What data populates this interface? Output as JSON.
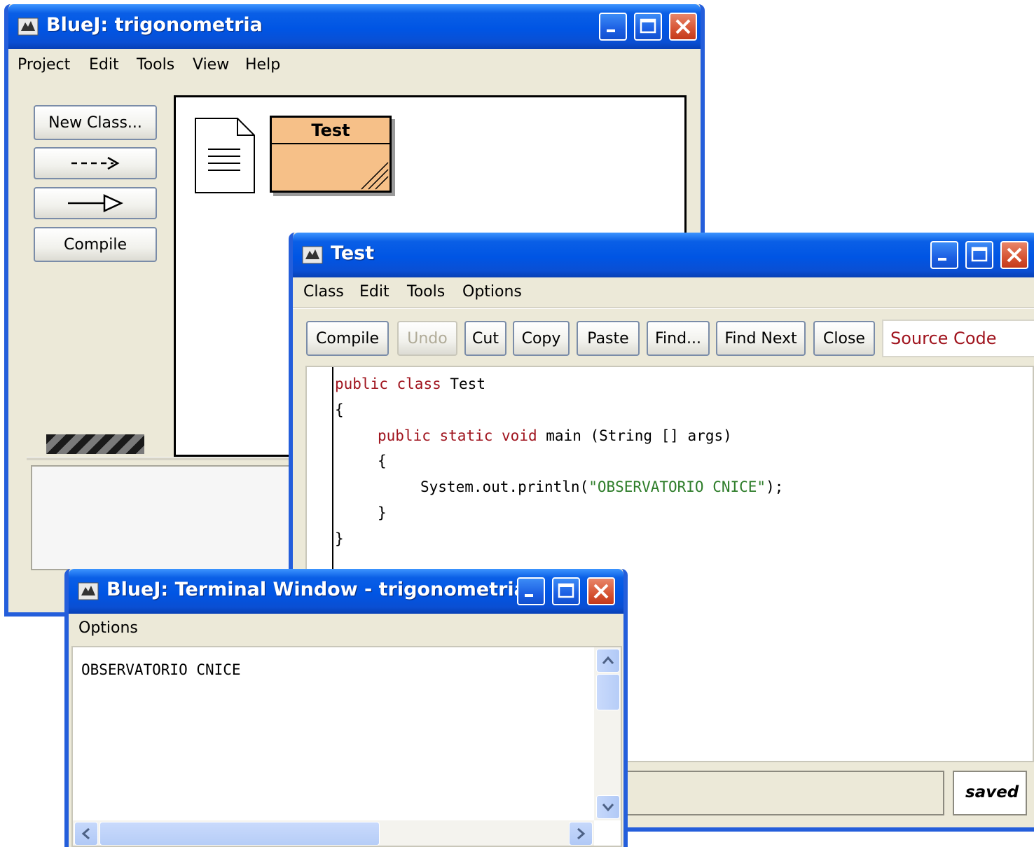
{
  "project_window": {
    "title": "BlueJ:  trigonometria",
    "menu": [
      "Project",
      "Edit",
      "Tools",
      "View",
      "Help"
    ],
    "buttons": {
      "new_class": "New Class...",
      "compile": "Compile"
    },
    "class_box": {
      "name": "Test",
      "fill": "#f6c088"
    }
  },
  "editor_window": {
    "title": "Test",
    "menu": [
      "Class",
      "Edit",
      "Tools",
      "Options"
    ],
    "toolbar": [
      "Compile",
      "Undo",
      "Cut",
      "Copy",
      "Paste",
      "Find...",
      "Find Next",
      "Close"
    ],
    "view_select": "Source Code",
    "code": {
      "line1": {
        "a": "public",
        "b": "class",
        "c": "Test"
      },
      "line2": "{",
      "line3": {
        "a": "public",
        "b": "static",
        "c": "void",
        "d": "main (String [] args)"
      },
      "line4": "{",
      "line5": {
        "a": "System.out.println(",
        "b": "\"OBSERVATORIO CNICE\"",
        "c": ");"
      },
      "line6": "}",
      "line7": "}"
    },
    "status": "saved"
  },
  "terminal_window": {
    "title": "BlueJ: Terminal Window - trigonometria",
    "menu": [
      "Options"
    ],
    "output": "OBSERVATORIO CNICE"
  },
  "colors": {
    "titlebar": "#0055e4",
    "window_bg": "#ece9d8",
    "keyword": "#a0141e",
    "string": "#2e7d2a"
  }
}
